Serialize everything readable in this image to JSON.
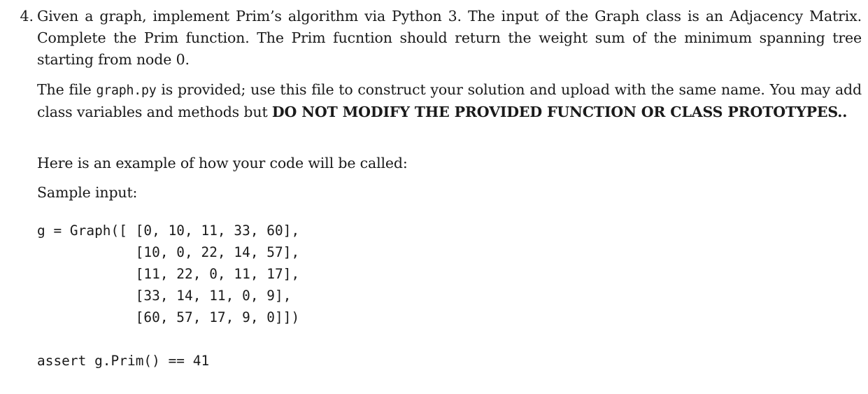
{
  "document": {
    "background_color": "#ffffff",
    "text_color": "#1a1a1a"
  },
  "problem": {
    "number": "4.",
    "paragraph_1": "Given a graph, implement Prim’s algorithm via Python 3. The input of the Graph class is an Adjacency Matrix. Complete the Prim function. The Prim fucntion should return the weight sum of the minimum spanning tree starting from node 0.",
    "paragraph_2_part_1": "The file ",
    "paragraph_2_filename": "graph.py",
    "paragraph_2_part_2": " is provided; use this file to construct your solution and upload with the same name. You may add class variables and methods but ",
    "paragraph_2_bold": "DO NOT MODIFY THE PROVIDED FUNCTION OR CLASS PROTOTYPES..",
    "paragraph_3": "Here is an example of how your code will be called:",
    "paragraph_4": "Sample input:",
    "code_sample": "g = Graph([ [0, 10, 11, 33, 60],\n            [10, 0, 22, 14, 57],\n            [11, 22, 0, 11, 17],\n            [33, 14, 11, 0, 9],\n            [60, 57, 17, 9, 0]])",
    "code_assert": "assert g.Prim() == 41"
  },
  "code_data": {
    "variable_name": "g",
    "class_name": "Graph",
    "adjacency_matrix": [
      [
        0,
        10,
        11,
        33,
        60
      ],
      [
        10,
        0,
        22,
        14,
        57
      ],
      [
        11,
        22,
        0,
        11,
        17
      ],
      [
        33,
        14,
        11,
        0,
        9
      ],
      [
        60,
        57,
        17,
        9,
        0
      ]
    ],
    "assert_method": "g.Prim()",
    "assert_expected_value": 41,
    "start_node": 0
  }
}
